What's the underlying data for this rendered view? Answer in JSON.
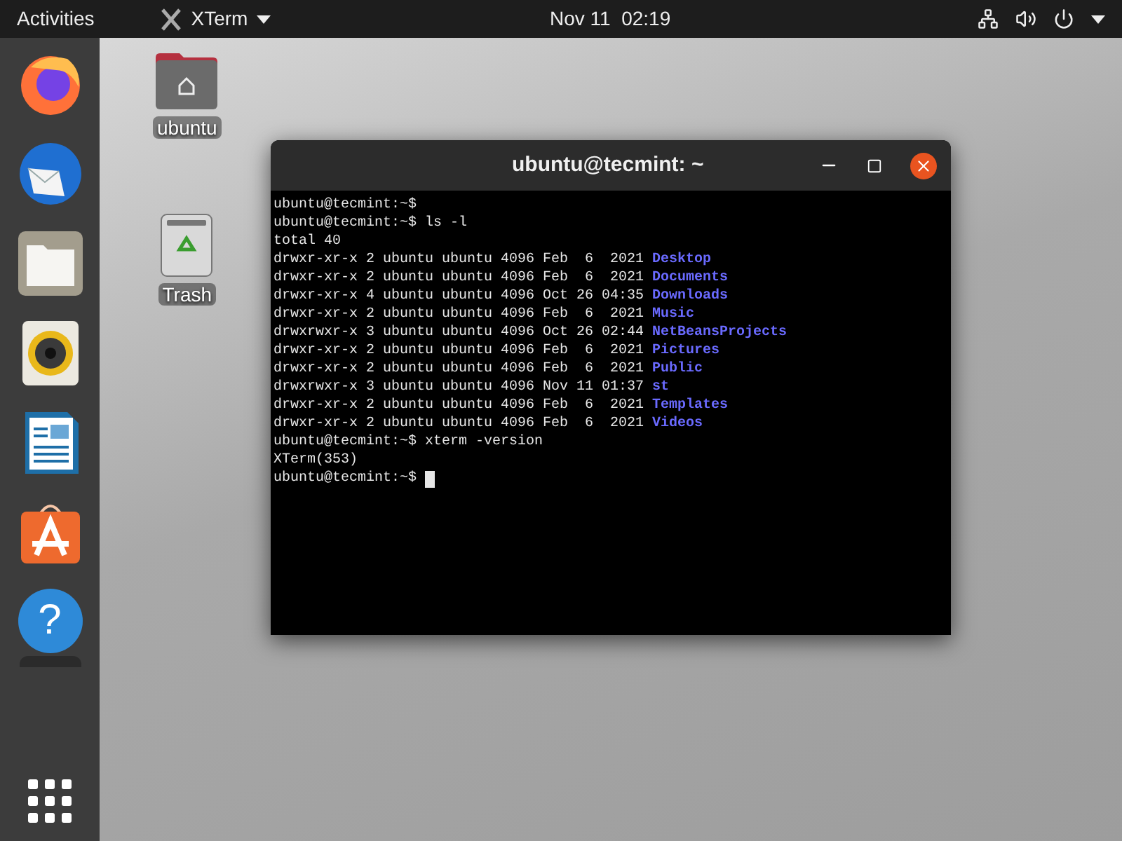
{
  "top_bar": {
    "activities": "Activities",
    "app_menu": "XTerm",
    "clock": "Nov 11  02:19"
  },
  "dock": {
    "items": [
      {
        "kind": "firefox"
      },
      {
        "kind": "thunderbird"
      },
      {
        "kind": "files"
      },
      {
        "kind": "rhythmbox"
      },
      {
        "kind": "writer"
      },
      {
        "kind": "software"
      },
      {
        "kind": "help",
        "glyph": "?"
      },
      {
        "kind": "partial"
      }
    ]
  },
  "desktop_icons": [
    {
      "kind": "home",
      "label": "ubuntu"
    },
    {
      "kind": "trash",
      "label": "Trash"
    }
  ],
  "window": {
    "title": "ubuntu@tecmint: ~",
    "lines": [
      {
        "kind": "plain",
        "text": "ubuntu@tecmint:~$"
      },
      {
        "kind": "plain",
        "text": "ubuntu@tecmint:~$ ls -l"
      },
      {
        "kind": "plain",
        "text": "total 40"
      },
      {
        "kind": "entry",
        "text": "drwxr-xr-x 2 ubuntu ubuntu 4096 Feb  6  2021",
        "name": "Desktop"
      },
      {
        "kind": "entry",
        "text": "drwxr-xr-x 2 ubuntu ubuntu 4096 Feb  6  2021",
        "name": "Documents"
      },
      {
        "kind": "entry",
        "text": "drwxr-xr-x 4 ubuntu ubuntu 4096 Oct 26 04:35",
        "name": "Downloads"
      },
      {
        "kind": "entry",
        "text": "drwxr-xr-x 2 ubuntu ubuntu 4096 Feb  6  2021",
        "name": "Music"
      },
      {
        "kind": "entry",
        "text": "drwxrwxr-x 3 ubuntu ubuntu 4096 Oct 26 02:44",
        "name": "NetBeansProjects"
      },
      {
        "kind": "entry",
        "text": "drwxr-xr-x 2 ubuntu ubuntu 4096 Feb  6  2021",
        "name": "Pictures"
      },
      {
        "kind": "entry",
        "text": "drwxr-xr-x 2 ubuntu ubuntu 4096 Feb  6  2021",
        "name": "Public"
      },
      {
        "kind": "entry",
        "text": "drwxrwxr-x 3 ubuntu ubuntu 4096 Nov 11 01:37",
        "name": "st"
      },
      {
        "kind": "entry",
        "text": "drwxr-xr-x 2 ubuntu ubuntu 4096 Feb  6  2021",
        "name": "Templates"
      },
      {
        "kind": "entry",
        "text": "drwxr-xr-x 2 ubuntu ubuntu 4096 Feb  6  2021",
        "name": "Videos"
      },
      {
        "kind": "plain",
        "text": "ubuntu@tecmint:~$ xterm -version"
      },
      {
        "kind": "plain",
        "text": "XTerm(353)"
      },
      {
        "kind": "cursor",
        "text": "ubuntu@tecmint:~$"
      }
    ]
  }
}
